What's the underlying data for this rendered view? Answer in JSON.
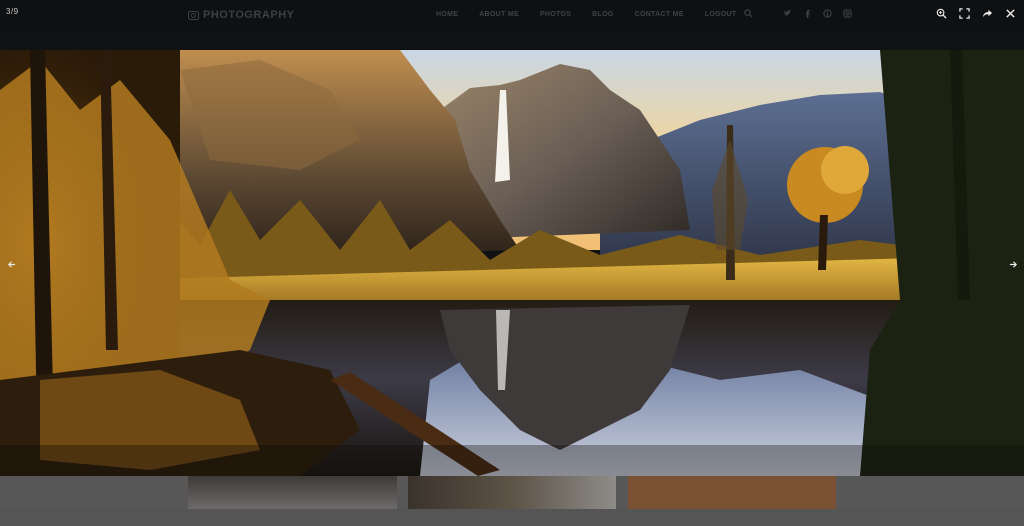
{
  "lightbox": {
    "counter": "3/9",
    "tools": [
      {
        "name": "zoom-icon"
      },
      {
        "name": "fullscreen-icon"
      },
      {
        "name": "share-icon"
      },
      {
        "name": "close-icon"
      }
    ]
  },
  "site": {
    "logo_text": "PHOTOGRAPHY",
    "nav": [
      "HOME",
      "ABOUT ME",
      "PHOTOS",
      "BLOG",
      "CONTACT ME",
      "LOGOUT"
    ],
    "icons": [
      "search-icon",
      "twitter-icon",
      "facebook-icon",
      "pinterest-icon",
      "instagram-icon"
    ]
  },
  "colors": {
    "overlay": "#101113",
    "sky_gold": "#f2c87a",
    "meadow": "#e0b23a",
    "water_blue": "#b8c8e6"
  },
  "photo": {
    "subject": "mountain-valley-waterfall-reflection"
  }
}
